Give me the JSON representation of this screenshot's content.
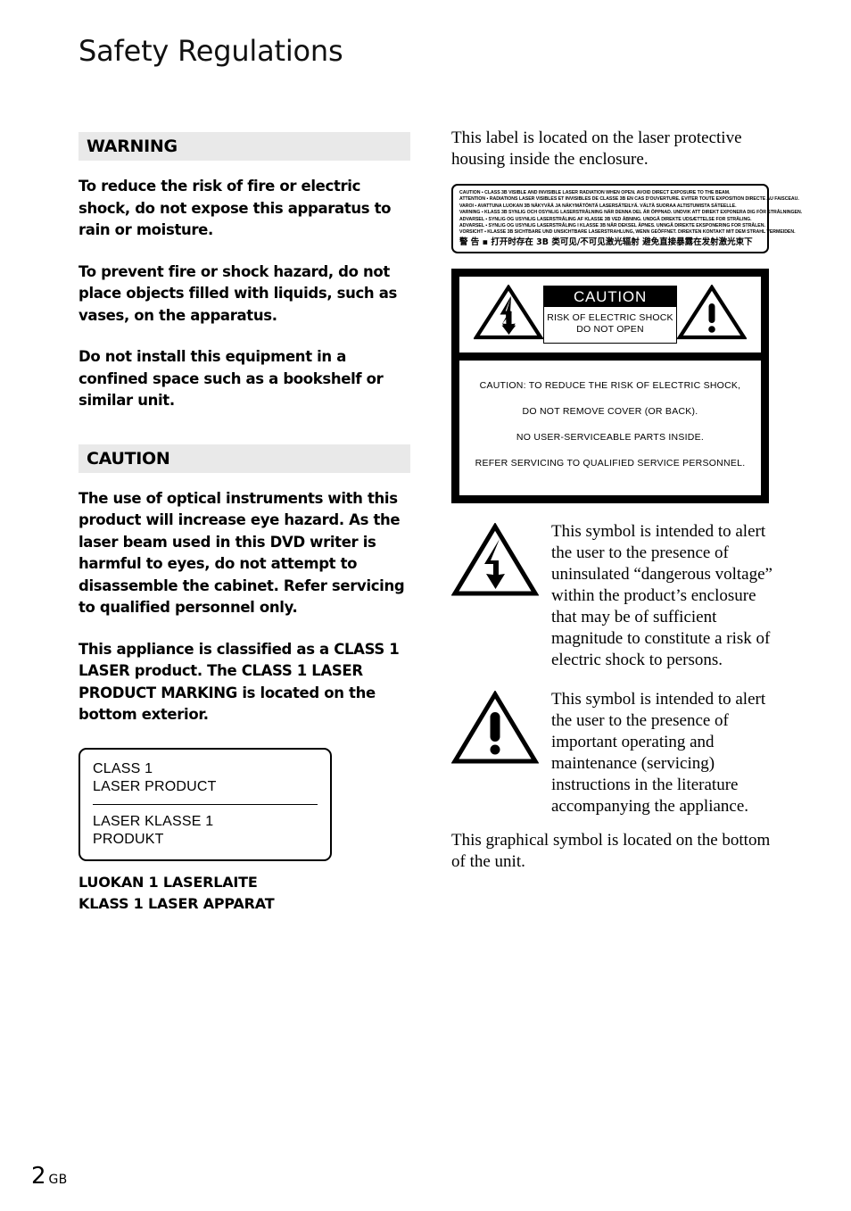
{
  "page": {
    "title": "Safety Regulations",
    "footer_page_number": "2",
    "footer_region": "GB"
  },
  "left_column": {
    "warning": {
      "heading": "WARNING",
      "paragraphs": [
        "To reduce the risk of fire or electric shock, do not expose this apparatus to rain or moisture.",
        "To prevent fire or shock hazard, do not place objects filled with liquids, such as vases, on the apparatus.",
        "Do not install this equipment in a confined space such as a bookshelf or similar unit."
      ]
    },
    "caution": {
      "heading": "CAUTION",
      "paragraphs": [
        "The use of optical instruments with this product will increase eye hazard. As the laser beam used in this DVD writer is harmful to eyes, do not attempt to disassemble the cabinet. Refer servicing to qualified personnel only.",
        "This appliance is classified as a CLASS 1 LASER product. The CLASS 1 LASER PRODUCT MARKING is located on the bottom exterior."
      ]
    },
    "laser_class_box": {
      "line1": "CLASS 1",
      "line2": "LASER PRODUCT",
      "line3": "LASER KLASSE 1",
      "line4": "PRODUKT"
    },
    "luokan_lines": [
      "LUOKAN 1 LASERLAITE",
      "KLASS 1 LASER APPARAT"
    ]
  },
  "right_column": {
    "intro_text": "This label is located on the laser protective housing inside the enclosure.",
    "laser_label": {
      "lines": [
        "CAUTION ▪ CLASS 3B VISIBLE AND INVISIBLE LASER RADIATION WHEN OPEN. AVOID DIRECT EXPOSURE TO THE BEAM.",
        "ATTENTION ▪ RADIATIONS LASER VISIBLES ET INVISIBLES DE CLASSE 3B EN CAS D'OUVERTURE. EVITER TOUTE EXPOSITION DIRECTE AU FAISCEAU.",
        "VAROI ▪ AVATTUNA LUOKAN 3B NÄKYVÄÄ JA NÄKYMÄTÖNTÄ LASERSÄTEILYÄ. VÄLTÄ SUORAA ALTISTUMISTA SÄTEELLE.",
        "VARNING ▪ KLASS 3B SYNLIG OCH OSYNLIG LASERSTRÅLNING NÄR DENNA DEL ÄR ÖPPNAD. UNDVIK ATT DIREKT EXPONERA DIG FÖR STRÅLNINGEN.",
        "ADVARSEL ▪ SYNLIG OG USYNLIG LASERSTRÅLING AF KLASSE 3B VED ÅBNING. UNDGÅ DIREKTE UDSÆTTELSE FOR STRÅLING.",
        "ADVARSEL ▪ SYNLIG OG USYNLIG LASERSTRÅLING I KLASSE 3B NÅR DEKSEL ÅPNES. UNNGÅ DIREKTE EKSPONERING FOR STRÅLEN.",
        "VORSICHT ▪ KLASSE 3B SICHTBARE UND UNSICHTBARE LASERSTRAHLUNG, WENN GEÖFFNET. DIREKTEN KONTAKT MIT DEM STRAHL VERMEIDEN."
      ],
      "cjk_line": "警 告 ▪ 打开时存在 3B 类可见/不可见激光辐射  避免直接暴露在发射激光束下"
    },
    "caution_box": {
      "plate_heading": "CAUTION",
      "plate_line1": "RISK OF ELECTRIC SHOCK",
      "plate_line2": "DO NOT OPEN",
      "body_lines": [
        "CAUTION: TO REDUCE THE RISK OF ELECTRIC SHOCK,",
        "DO NOT REMOVE COVER (OR BACK).",
        "NO USER-SERVICEABLE PARTS INSIDE.",
        "REFER SERVICING TO QUALIFIED SERVICE PERSONNEL."
      ]
    },
    "symbol_lightning_text": "This symbol is intended to alert the user to the presence of uninsulated “dangerous voltage” within the product’s enclosure that may be of sufficient magnitude to constitute a risk of electric shock to persons.",
    "symbol_exclamation_text": "This symbol is intended to alert the user to the presence of important operating and maintenance (servicing) instructions in the literature accompanying the appliance.",
    "closing_text": "This graphical symbol is located on the bottom of the unit."
  },
  "colors": {
    "band_background": "#e9e9e9",
    "text": "#000000",
    "page_background": "#ffffff"
  }
}
